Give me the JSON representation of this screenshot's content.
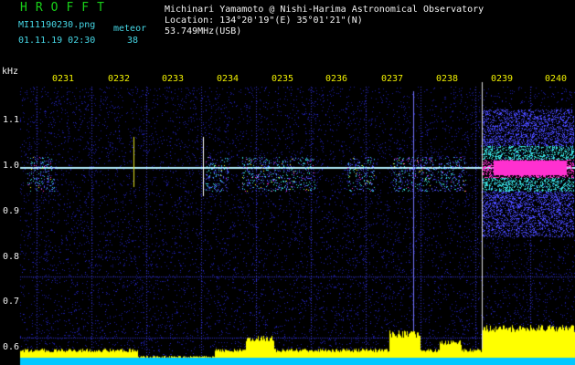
{
  "header": {
    "brand": "HROFFT",
    "file_name": "MI11190230.png",
    "meteor_label": "meteor",
    "datetime": "01.11.19 02:30",
    "meteor_count": "38",
    "observer": "Michinari Yamamoto @ Nishi-Harima Astronomical Observatory",
    "location": "Location: 134°20'19\"(E) 35°01'21\"(N)",
    "frequency": "53.749MHz(USB)"
  },
  "spectrogram": {
    "freq_unit": "kHz",
    "freq_ticks": [
      "1.1",
      "1.0",
      "0.9",
      "0.8",
      "0.7",
      "0.6"
    ],
    "time_ticks": [
      "0231",
      "0232",
      "0233",
      "0234",
      "0235",
      "0236",
      "0237",
      "0238",
      "0239",
      "0240"
    ],
    "colors": {
      "background": "#000000",
      "noise": "#1c1ca0",
      "carrier": "#b4f0ff",
      "echo_hot": "#ff30d0",
      "echo_warm": "#ffff20",
      "level_fill": "#ffff00",
      "baseline": "#00c8ff",
      "grid_dot": "#3030c0"
    }
  }
}
